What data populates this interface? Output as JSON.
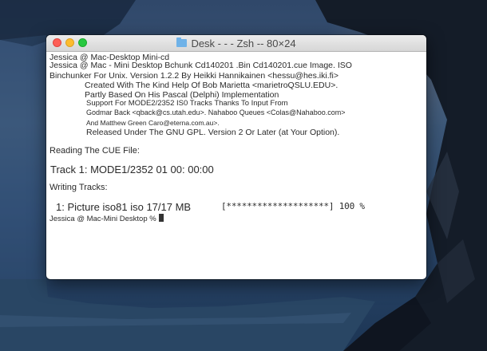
{
  "window": {
    "title": "Desk - - - Zsh -- 80×24"
  },
  "terminal": {
    "lines": [
      "Jessica @ Mac-Desktop Mini-cd",
      "Jessica @ Mac - Mini Desktop Bchunk Cd140201 .Bin Cd140201.cue Image. ISO",
      "Binchunker For Unix. Version 1.2.2 By Heikki Hannikainen <hessu@hes.iki.fi>",
      "Created With The Kind Help Of Bob Marietta <marietroQSLU.EDU>.",
      "Partly Based On His Pascal (Delphi) Implementation",
      "Support For MODE2/2352 IS0 Tracks Thanks To Input From",
      "Godmar Back <qback@cs.utah.edu>. Nahaboo Queues <Colas@Nahaboo.com>",
      "And Matthew Green Caro@eterna.com.au>.",
      "Released Under The GNU GPL. Version 2 Or Later (at Your Option).",
      "Reading The CUE File:",
      "Track 1: MODE1/2352 01 00: 00:00",
      "Writing Tracks:",
      "1: Picture iso81 iso 17/17 MB",
      "[********************] 100 %",
      "Jessica @ Mac-Mini Desktop %"
    ]
  }
}
